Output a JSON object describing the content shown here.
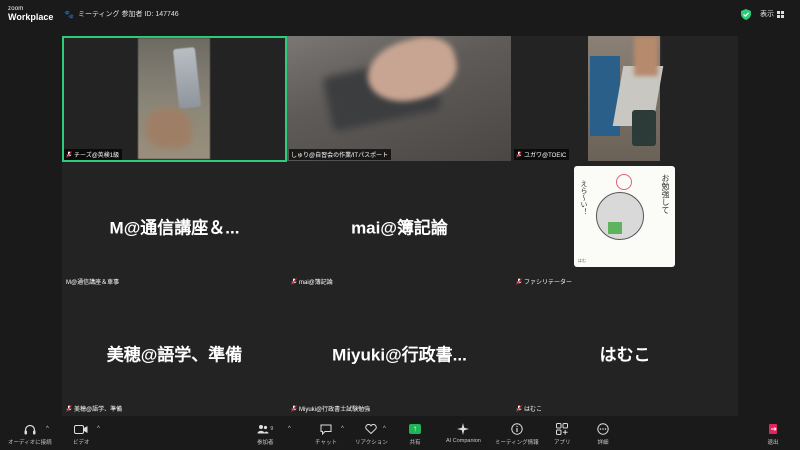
{
  "app": {
    "logo_line1": "zoom",
    "logo_line2": "Workplace"
  },
  "meeting": {
    "title": "ミーティング 参加者 ID: 147746"
  },
  "header": {
    "view_label": "表示"
  },
  "tiles": [
    {
      "name_tag": "チーズ@英検1級",
      "big_name": ""
    },
    {
      "name_tag": "しゅり@自習会の作業/ITパスポート",
      "big_name": ""
    },
    {
      "name_tag": "ユガワ@TOEIC",
      "big_name": ""
    },
    {
      "name_tag": "M@通信講座＆車事",
      "big_name": "M@通信講座＆..."
    },
    {
      "name_tag": "mai@簿記論",
      "big_name": "mai@簿記論"
    },
    {
      "name_tag": "ファシリテーター",
      "big_name": ""
    },
    {
      "name_tag": "美穂@語学、準備",
      "big_name": "美穂@語学、準備"
    },
    {
      "name_tag": "Miyuki@行政書士試験勉強",
      "big_name": "Miyuki@行政書..."
    },
    {
      "name_tag": "はむこ",
      "big_name": "はむこ"
    }
  ],
  "facilitator_image": {
    "text_right": "お勉強して",
    "text_left": "えら〜い！",
    "book_text": "すごい",
    "signature": "はむ"
  },
  "toolbar": {
    "audio_label": "オーディオに接続",
    "video_label": "ビデオ",
    "participants_label": "参加者",
    "participants_count": "9",
    "chat_label": "チャット",
    "reactions_label": "リアクション",
    "share_label": "共有",
    "ai_label": "AI Companion",
    "info_label": "ミーティング情報",
    "apps_label": "アプリ",
    "more_label": "詳細",
    "leave_label": "退出"
  },
  "colors": {
    "active_border": "#2ecb7a",
    "share_green": "#1fb455",
    "leave_red": "#e0245e",
    "mic_muted_red": "#e0243a"
  }
}
